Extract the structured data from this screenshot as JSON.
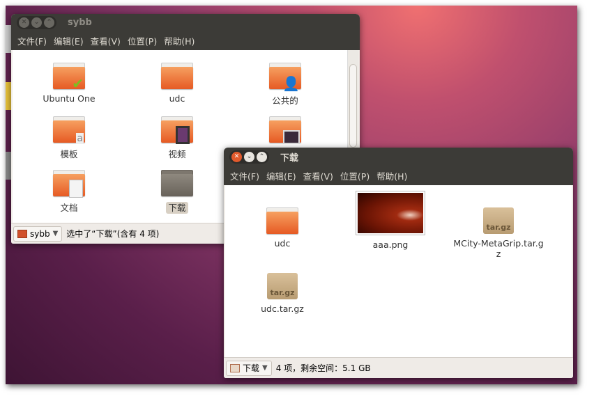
{
  "window1": {
    "title": "sybb",
    "menu": [
      "文件(F)",
      "编辑(E)",
      "查看(V)",
      "位置(P)",
      "帮助(H)"
    ],
    "items": [
      {
        "label": "Ubuntu One",
        "icon": "check"
      },
      {
        "label": "udc",
        "icon": "plain"
      },
      {
        "label": "公共的",
        "icon": "person"
      },
      {
        "label": "模板",
        "icon": "template"
      },
      {
        "label": "视频",
        "icon": "film"
      },
      {
        "label": "",
        "icon": "pictures"
      },
      {
        "label": "文档",
        "icon": "document"
      },
      {
        "label": "下载",
        "icon": "downloads"
      }
    ],
    "location": "sybb",
    "status": "选中了“下载”(含有 4 项)"
  },
  "window2": {
    "title": "下载",
    "menu": [
      "文件(F)",
      "编辑(E)",
      "查看(V)",
      "位置(P)",
      "帮助(H)"
    ],
    "items": [
      {
        "label": "udc"
      },
      {
        "label": "aaa.png"
      },
      {
        "label": "MCity-MetaGrip.tar.gz",
        "badge": "tar.gz"
      },
      {
        "label": "udc.tar.gz",
        "badge": "tar.gz"
      }
    ],
    "location": "下载",
    "status": "4 项，剩余空间：5.1 GB"
  }
}
